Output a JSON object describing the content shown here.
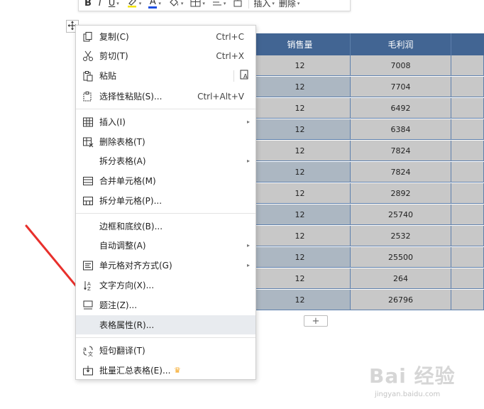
{
  "toolbar": {
    "bold": "B",
    "italic": "I",
    "underline": "U",
    "font_color": "A",
    "insert_label": "插入",
    "delete_label": "删除"
  },
  "table": {
    "headers": [
      "销售量",
      "毛利润",
      ""
    ],
    "rows": [
      [
        "12",
        "7008"
      ],
      [
        "12",
        "7704"
      ],
      [
        "12",
        "6492"
      ],
      [
        "12",
        "6384"
      ],
      [
        "12",
        "7824"
      ],
      [
        "12",
        "7824"
      ],
      [
        "12",
        "2892"
      ],
      [
        "12",
        "25740"
      ],
      [
        "12",
        "2532"
      ],
      [
        "12",
        "25500"
      ],
      [
        "12",
        "264"
      ],
      [
        "12",
        "26796"
      ]
    ],
    "add_row_label": "+"
  },
  "menu": {
    "items": [
      {
        "label": "复制(C)",
        "shortcut": "Ctrl+C",
        "icon": "copy-icon"
      },
      {
        "label": "剪切(T)",
        "shortcut": "Ctrl+X",
        "icon": "scissors-icon"
      },
      {
        "label": "粘贴",
        "shortcut": "",
        "icon": "paste-icon"
      },
      {
        "label": "选择性粘贴(S)...",
        "shortcut": "Ctrl+Alt+V",
        "icon": "paste-special-icon"
      },
      {
        "label": "插入(I)",
        "shortcut": "",
        "icon": "table-insert-icon"
      },
      {
        "label": "删除表格(T)",
        "shortcut": "",
        "icon": "table-delete-icon"
      },
      {
        "label": "拆分表格(A)",
        "shortcut": "",
        "icon": ""
      },
      {
        "label": "合并单元格(M)",
        "shortcut": "",
        "icon": "merge-cells-icon"
      },
      {
        "label": "拆分单元格(P)...",
        "shortcut": "",
        "icon": "split-cells-icon"
      },
      {
        "label": "边框和底纹(B)...",
        "shortcut": "",
        "icon": ""
      },
      {
        "label": "自动调整(A)",
        "shortcut": "",
        "icon": ""
      },
      {
        "label": "单元格对齐方式(G)",
        "shortcut": "",
        "icon": "cell-align-icon"
      },
      {
        "label": "文字方向(X)...",
        "shortcut": "",
        "icon": "text-direction-icon"
      },
      {
        "label": "题注(Z)...",
        "shortcut": "",
        "icon": "caption-icon"
      },
      {
        "label": "表格属性(R)...",
        "shortcut": "",
        "icon": ""
      },
      {
        "label": "短句翻译(T)",
        "shortcut": "",
        "icon": "translate-icon"
      },
      {
        "label": "批量汇总表格(E)...",
        "shortcut": "",
        "icon": "batch-summary-icon"
      }
    ],
    "submenu_arrow": "▸",
    "crown": "♛"
  },
  "watermark": {
    "main": "Bai 经验",
    "sub": "jingyan.baidu.com"
  },
  "colors": {
    "header_bg": "#426593",
    "highlight": "#e8ebef",
    "arrow": "#e8302c"
  }
}
